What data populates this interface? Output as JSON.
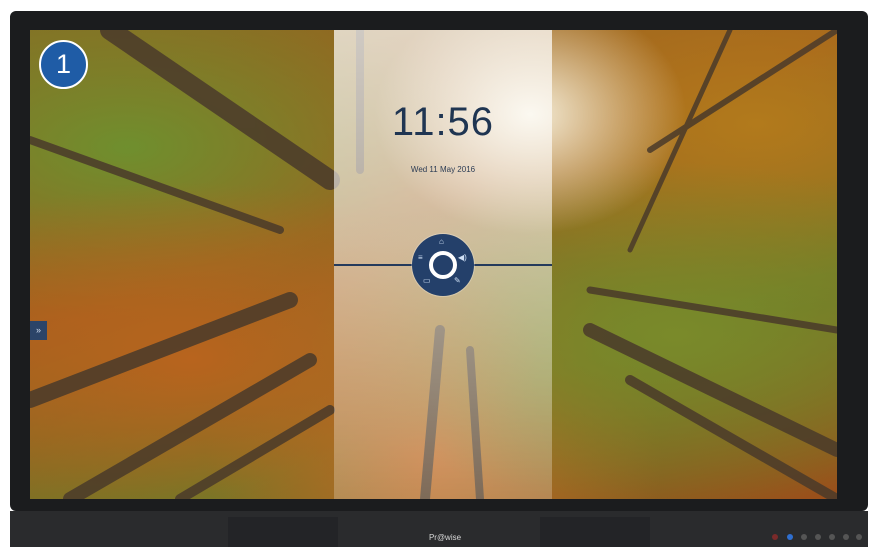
{
  "badge": {
    "number": "1"
  },
  "home": {
    "time": "11:56",
    "date": "Wed 11 May 2016"
  },
  "center_menu": {
    "items": [
      {
        "name": "home-icon",
        "glyph": "⌂"
      },
      {
        "name": "menu-lines-icon",
        "glyph": "≡"
      },
      {
        "name": "volume-icon",
        "glyph": "◀)"
      },
      {
        "name": "display-icon",
        "glyph": "▭"
      },
      {
        "name": "pen-icon",
        "glyph": "✎"
      }
    ]
  },
  "side_toolbar": {
    "items": [
      {
        "name": "globe-icon",
        "glyph": "⊕"
      },
      {
        "name": "user-icon",
        "glyph": "♙"
      },
      {
        "name": "whiteboard-icon",
        "glyph": "▤"
      },
      {
        "name": "source-icon",
        "glyph": "⊡"
      },
      {
        "name": "wifi-icon",
        "glyph": "⌔"
      },
      {
        "name": "bluetooth-icon",
        "glyph": "✱"
      },
      {
        "name": "settings-icon",
        "glyph": "◎"
      },
      {
        "name": "power-icon",
        "glyph": "⏻"
      },
      {
        "name": "collapse-icon",
        "glyph": "«"
      }
    ]
  },
  "left_tab": {
    "glyph": "»"
  },
  "monitor": {
    "brand": "Pr@wise"
  }
}
